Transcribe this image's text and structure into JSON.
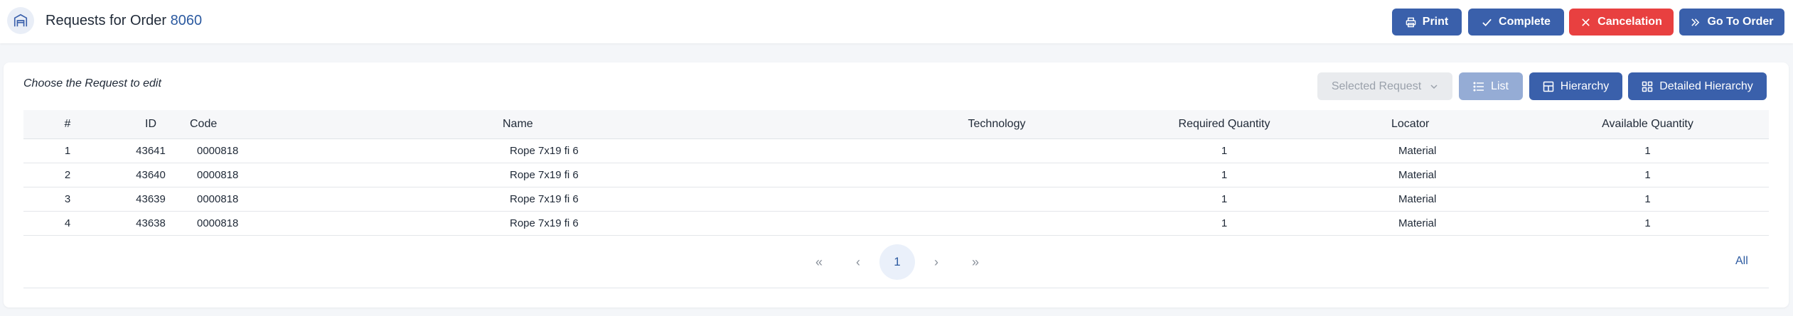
{
  "header": {
    "title_prefix": "Requests for Order",
    "order_number": "8060",
    "buttons": {
      "print": "Print",
      "complete": "Complete",
      "cancelation": "Cancelation",
      "go_to_order": "Go To Order"
    },
    "colors": {
      "primary": "#3a60ab",
      "danger": "#e84040"
    }
  },
  "card": {
    "heading": "Choose the Request to edit",
    "selected_request_placeholder": "Selected Request",
    "view_buttons": {
      "list": "List",
      "hierarchy": "Hierarchy",
      "detailed_hierarchy": "Detailed Hierarchy"
    }
  },
  "table": {
    "columns": {
      "num": "#",
      "id": "ID",
      "code": "Code",
      "name": "Name",
      "technology": "Technology",
      "required_quantity": "Required Quantity",
      "locator": "Locator",
      "available_quantity": "Available Quantity"
    },
    "rows": [
      {
        "num": "1",
        "id": "43641",
        "code": "0000818",
        "name": "Rope 7x19 fi 6",
        "technology": "",
        "required_quantity": "1",
        "locator": "Material",
        "available_quantity": "1"
      },
      {
        "num": "2",
        "id": "43640",
        "code": "0000818",
        "name": "Rope 7x19 fi 6",
        "technology": "",
        "required_quantity": "1",
        "locator": "Material",
        "available_quantity": "1"
      },
      {
        "num": "3",
        "id": "43639",
        "code": "0000818",
        "name": "Rope 7x19 fi 6",
        "technology": "",
        "required_quantity": "1",
        "locator": "Material",
        "available_quantity": "1"
      },
      {
        "num": "4",
        "id": "43638",
        "code": "0000818",
        "name": "Rope 7x19 fi 6",
        "technology": "",
        "required_quantity": "1",
        "locator": "Material",
        "available_quantity": "1"
      }
    ]
  },
  "pagination": {
    "first": "«",
    "prev": "‹",
    "current_page": "1",
    "next": "›",
    "last": "»",
    "page_size": "All"
  }
}
